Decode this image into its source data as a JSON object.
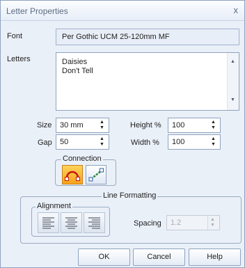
{
  "dialog": {
    "title": "Letter Properties",
    "close_label": "x"
  },
  "font": {
    "label": "Font",
    "value": "Per Gothic UCM 25-120mm MF"
  },
  "letters": {
    "label": "Letters",
    "lines": [
      "Daisies",
      "Don't Tell"
    ]
  },
  "size": {
    "label": "Size",
    "value": "30 mm"
  },
  "gap": {
    "label": "Gap",
    "value": "50"
  },
  "height": {
    "label": "Height %",
    "value": "100"
  },
  "width": {
    "label": "Width %",
    "value": "100"
  },
  "connection": {
    "legend": "Connection",
    "icons": [
      "arch-connection-icon",
      "diagonal-connection-icon"
    ],
    "active": "arch"
  },
  "line_formatting": {
    "legend": "Line Formatting",
    "alignment_legend": "Alignment",
    "alignment_icons": [
      "align-left-icon",
      "align-center-icon",
      "align-right-icon"
    ],
    "spacing_label": "Spacing",
    "spacing_value": "1.2"
  },
  "buttons": {
    "ok": "OK",
    "cancel": "Cancel",
    "help": "Help"
  },
  "colors": {
    "title_text": "#5b6b82",
    "panel": "#eaf0f8",
    "active_icon": "#f7a21b",
    "border": "#8ea2bf"
  }
}
